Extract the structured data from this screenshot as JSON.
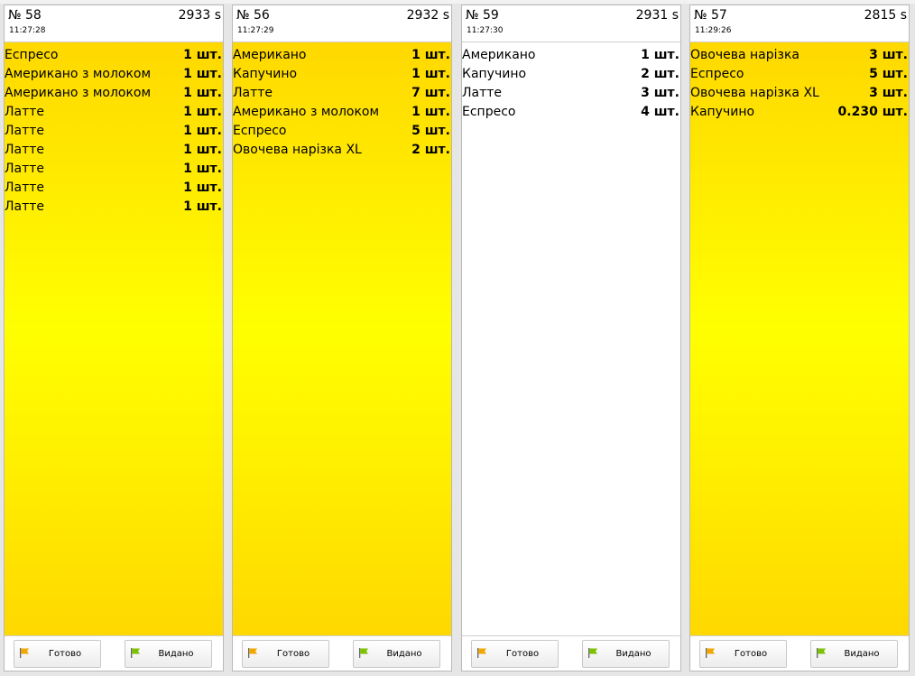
{
  "ui": {
    "ready_label": "Готово",
    "issued_label": "Видано",
    "ready_flag_color": "#f0a800",
    "issued_flag_color": "#7cc200"
  },
  "orders": [
    {
      "number": "№ 58",
      "time": "11:27:28",
      "seconds": "2933 s",
      "highlight": "yellow",
      "items": [
        {
          "name": "Еспресо",
          "qty": "1 шт."
        },
        {
          "name": "Американо з молоком",
          "qty": "1 шт."
        },
        {
          "name": "Американо з молоком",
          "qty": "1 шт."
        },
        {
          "name": "Латте",
          "qty": "1 шт."
        },
        {
          "name": "Латте",
          "qty": "1 шт."
        },
        {
          "name": "Латте",
          "qty": "1 шт."
        },
        {
          "name": "Латте",
          "qty": "1 шт."
        },
        {
          "name": "Латте",
          "qty": "1 шт."
        },
        {
          "name": "Латте",
          "qty": "1 шт."
        }
      ]
    },
    {
      "number": "№ 56",
      "time": "11:27:29",
      "seconds": "2932 s",
      "highlight": "yellow",
      "items": [
        {
          "name": "Американо",
          "qty": "1 шт."
        },
        {
          "name": "Капучино",
          "qty": "1 шт."
        },
        {
          "name": "Латте",
          "qty": "7 шт."
        },
        {
          "name": "Американо з молоком",
          "qty": "1 шт."
        },
        {
          "name": "Еспресо",
          "qty": "5 шт."
        },
        {
          "name": "Овочева нарізка XL",
          "qty": "2 шт."
        }
      ]
    },
    {
      "number": "№ 59",
      "time": "11:27:30",
      "seconds": "2931 s",
      "highlight": "white",
      "items": [
        {
          "name": "Американо",
          "qty": "1 шт."
        },
        {
          "name": "Капучино",
          "qty": "2 шт."
        },
        {
          "name": "Латте",
          "qty": "3 шт."
        },
        {
          "name": "Еспресо",
          "qty": "4 шт."
        }
      ]
    },
    {
      "number": "№ 57",
      "time": "11:29:26",
      "seconds": "2815 s",
      "highlight": "yellow",
      "items": [
        {
          "name": "Овочева нарізка",
          "qty": "3 шт."
        },
        {
          "name": "Еспресо",
          "qty": "5 шт."
        },
        {
          "name": "Овочева нарізка XL",
          "qty": "3 шт."
        },
        {
          "name": "Капучино",
          "qty": "0.230 шт."
        }
      ]
    }
  ]
}
